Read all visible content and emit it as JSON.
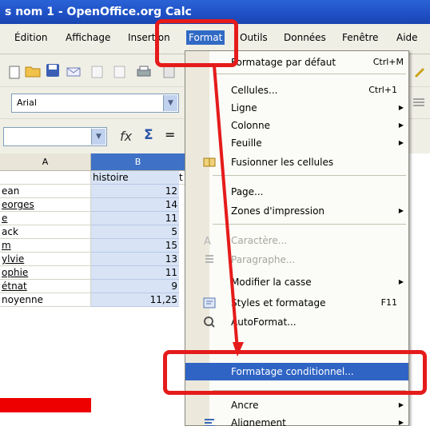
{
  "window": {
    "title": "s nom 1 - OpenOffice.org Calc"
  },
  "menubar": [
    {
      "label": "Édition"
    },
    {
      "label": "Affichage"
    },
    {
      "label": "Insertion"
    },
    {
      "label": "Format",
      "active": true
    },
    {
      "label": "Outils"
    },
    {
      "label": "Données"
    },
    {
      "label": "Fenêtre"
    },
    {
      "label": "Aide"
    }
  ],
  "toolbar": {
    "font_name": "Arial"
  },
  "formula_bar": {
    "fx_symbol": "fx",
    "sigma_symbol": "Σ",
    "equals_symbol": "="
  },
  "grid": {
    "columns": [
      {
        "label": "A"
      },
      {
        "label": "B"
      }
    ],
    "rows": [
      {
        "a": "",
        "b": "histoire",
        "b_align": "left",
        "c": "t"
      },
      {
        "a": "ean",
        "b": "12",
        "c": ""
      },
      {
        "a": "eorges",
        "b": "14",
        "c": ""
      },
      {
        "a": "e",
        "b": "11",
        "c": ""
      },
      {
        "a": "ack",
        "b": "5",
        "c": ""
      },
      {
        "a": "m",
        "b": "15",
        "c": ""
      },
      {
        "a": "ylvie",
        "b": "13",
        "c": ""
      },
      {
        "a": "ophie",
        "b": "11",
        "c": ""
      },
      {
        "a": "étnat",
        "b": "9",
        "c": ""
      },
      {
        "a": "noyenne",
        "b": "11,25",
        "c": ""
      }
    ]
  },
  "format_menu": {
    "items": [
      {
        "label": "Formatage par défaut",
        "shortcut": "Ctrl+M"
      },
      {
        "label": "Cellules...",
        "shortcut": "Ctrl+1"
      },
      {
        "label": "Ligne",
        "submenu": true
      },
      {
        "label": "Colonne",
        "submenu": true
      },
      {
        "label": "Feuille",
        "submenu": true
      },
      {
        "label": "Fusionner les cellules"
      },
      {
        "label": "Page..."
      },
      {
        "label": "Zones d'impression",
        "submenu": true
      },
      {
        "label": "Caractère...",
        "disabled": true
      },
      {
        "label": "Paragraphe...",
        "disabled": true
      },
      {
        "label": "Modifier la casse",
        "submenu": true
      },
      {
        "label": "Styles et formatage",
        "shortcut": "F11"
      },
      {
        "label": "AutoFormat..."
      },
      {
        "label": "Formatage conditionnel...",
        "highlighted": true
      },
      {
        "label": "Ancre",
        "submenu": true
      },
      {
        "label": "Alignement",
        "submenu": true
      }
    ]
  },
  "colors": {
    "annotation": "#e51b1b",
    "highlight": "#2f64c4",
    "titlebar": "#1e4fc4",
    "red_cell": "#ee0000"
  }
}
